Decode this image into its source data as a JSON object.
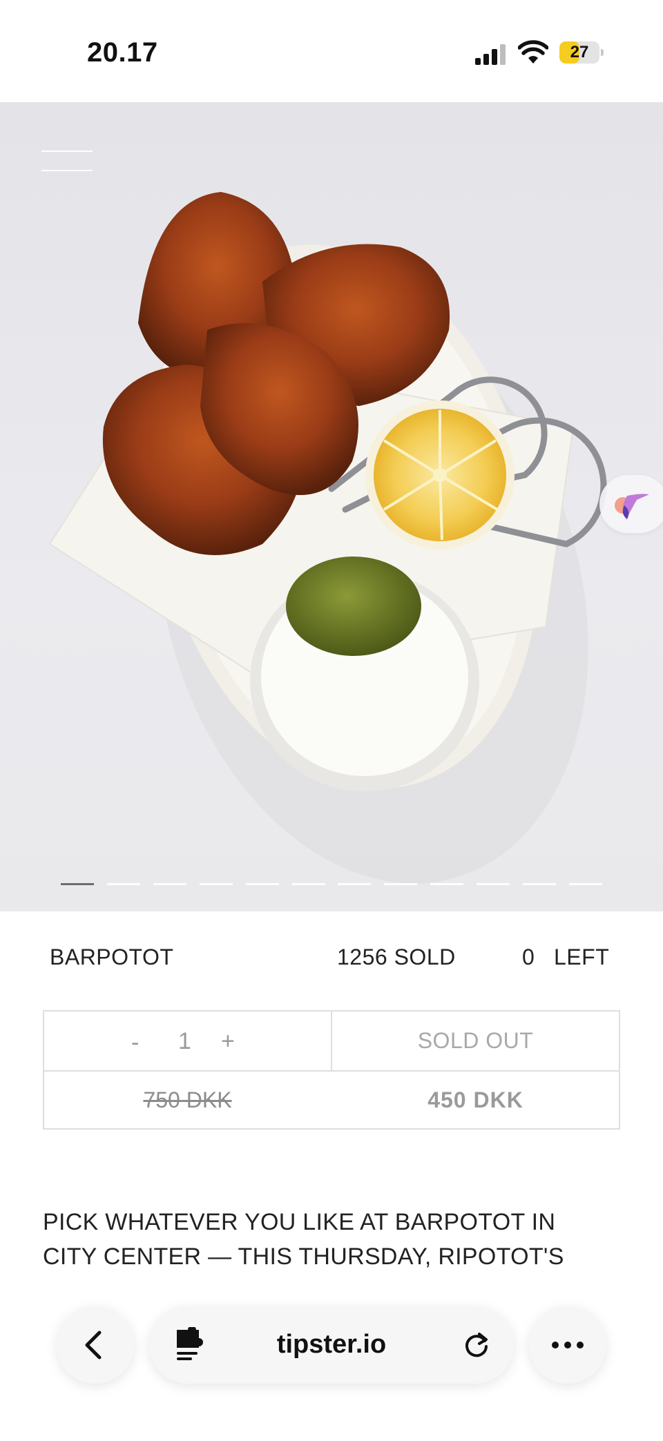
{
  "status_bar": {
    "time": "20.17",
    "battery_level": "27",
    "battery_color": "#f5cc1f",
    "icons": [
      "cellular-signal-icon",
      "wifi-icon",
      "battery-icon"
    ]
  },
  "hero": {
    "slide_count": 12,
    "active_slide": 1,
    "icons": [
      "menu-icon",
      "hummingbird-logo-icon"
    ]
  },
  "deal": {
    "venue": "BARPOTOT",
    "sold_label": "1256 SOLD",
    "left_count": "0",
    "left_label": "LEFT"
  },
  "purchase": {
    "minus": "-",
    "quantity": "1",
    "plus": "+",
    "status": "SOLD OUT",
    "original_price": "750 DKK",
    "price": "450 DKK"
  },
  "description": {
    "line1": "PICK WHATEVER YOU LIKE AT BARPOTOT IN",
    "line2": "CITY CENTER — THIS THURSDAY, RIPOTOT'S"
  },
  "browser": {
    "url": "tipster.io",
    "icons": [
      "back-chevron-icon",
      "reader-extension-icon",
      "reload-icon",
      "more-icon"
    ]
  }
}
